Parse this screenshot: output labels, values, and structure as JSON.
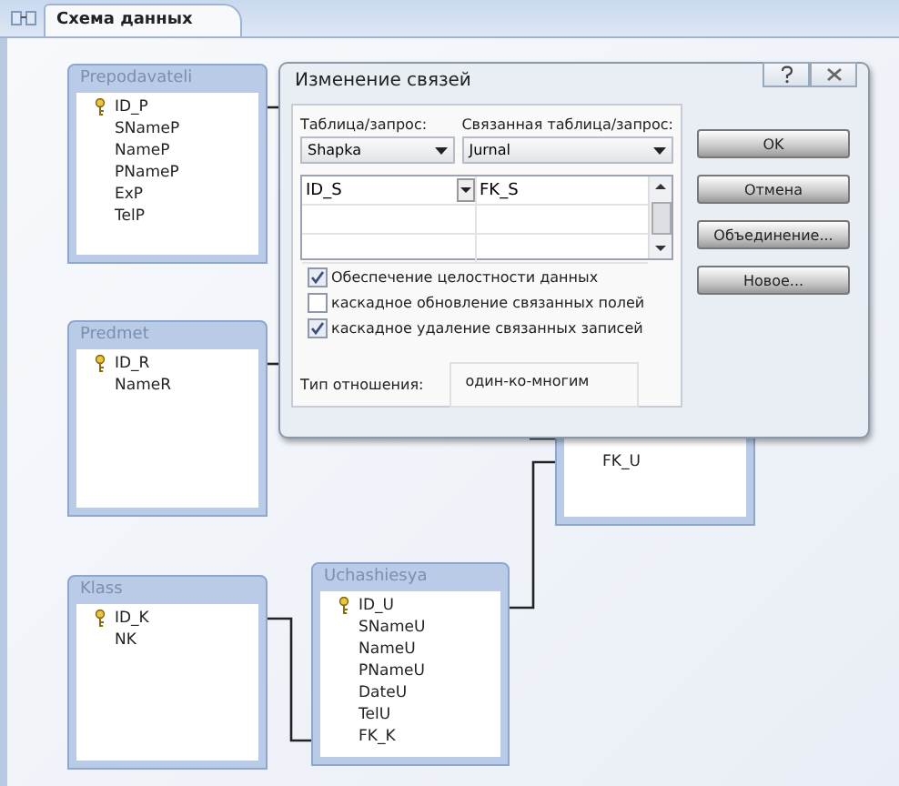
{
  "tabs": [
    {
      "label": "Схема данных",
      "selected": true
    }
  ],
  "tables": [
    {
      "name": "Prepodavateli",
      "fields": [
        {
          "name": "ID_P",
          "primary_key": true
        },
        {
          "name": "SNameP",
          "primary_key": false
        },
        {
          "name": "NameP",
          "primary_key": false
        },
        {
          "name": "PNameP",
          "primary_key": false
        },
        {
          "name": "ExP",
          "primary_key": false
        },
        {
          "name": "TelP",
          "primary_key": false
        }
      ]
    },
    {
      "name": "Predmet",
      "fields": [
        {
          "name": "ID_R",
          "primary_key": true
        },
        {
          "name": "NameR",
          "primary_key": false
        }
      ]
    },
    {
      "name": "Klass",
      "fields": [
        {
          "name": "ID_K",
          "primary_key": true
        },
        {
          "name": "NK",
          "primary_key": false
        }
      ]
    },
    {
      "name": "Uchashiesya",
      "fields": [
        {
          "name": "ID_U",
          "primary_key": true
        },
        {
          "name": "SNameU",
          "primary_key": false
        },
        {
          "name": "NameU",
          "primary_key": false
        },
        {
          "name": "PNameU",
          "primary_key": false
        },
        {
          "name": "DateU",
          "primary_key": false
        },
        {
          "name": "TelU",
          "primary_key": false
        },
        {
          "name": "FK_K",
          "primary_key": false
        }
      ]
    },
    {
      "fields": [
        {
          "name": "FK_U",
          "primary_key": false
        }
      ]
    }
  ],
  "dialog": {
    "title": "Изменение связей",
    "table_label": "Таблица/запрос:",
    "related_label": "Связанная таблица/запрос:",
    "table": "Shapka",
    "related_table": "Jurnal",
    "field_pairs": [
      {
        "field": "ID_S",
        "related_field": "FK_S"
      }
    ],
    "checkboxes": [
      {
        "label": "Обеспечение целостности данных",
        "checked": true
      },
      {
        "label": "каскадное обновление связанных полей",
        "checked": false
      },
      {
        "label": "каскадное удаление связанных записей",
        "checked": true
      }
    ],
    "relation_label": "Тип отношения:",
    "relation_type": "один-ко-многим",
    "buttons": [
      "OK",
      "Отмена",
      "Объединение...",
      "Новое..."
    ]
  }
}
